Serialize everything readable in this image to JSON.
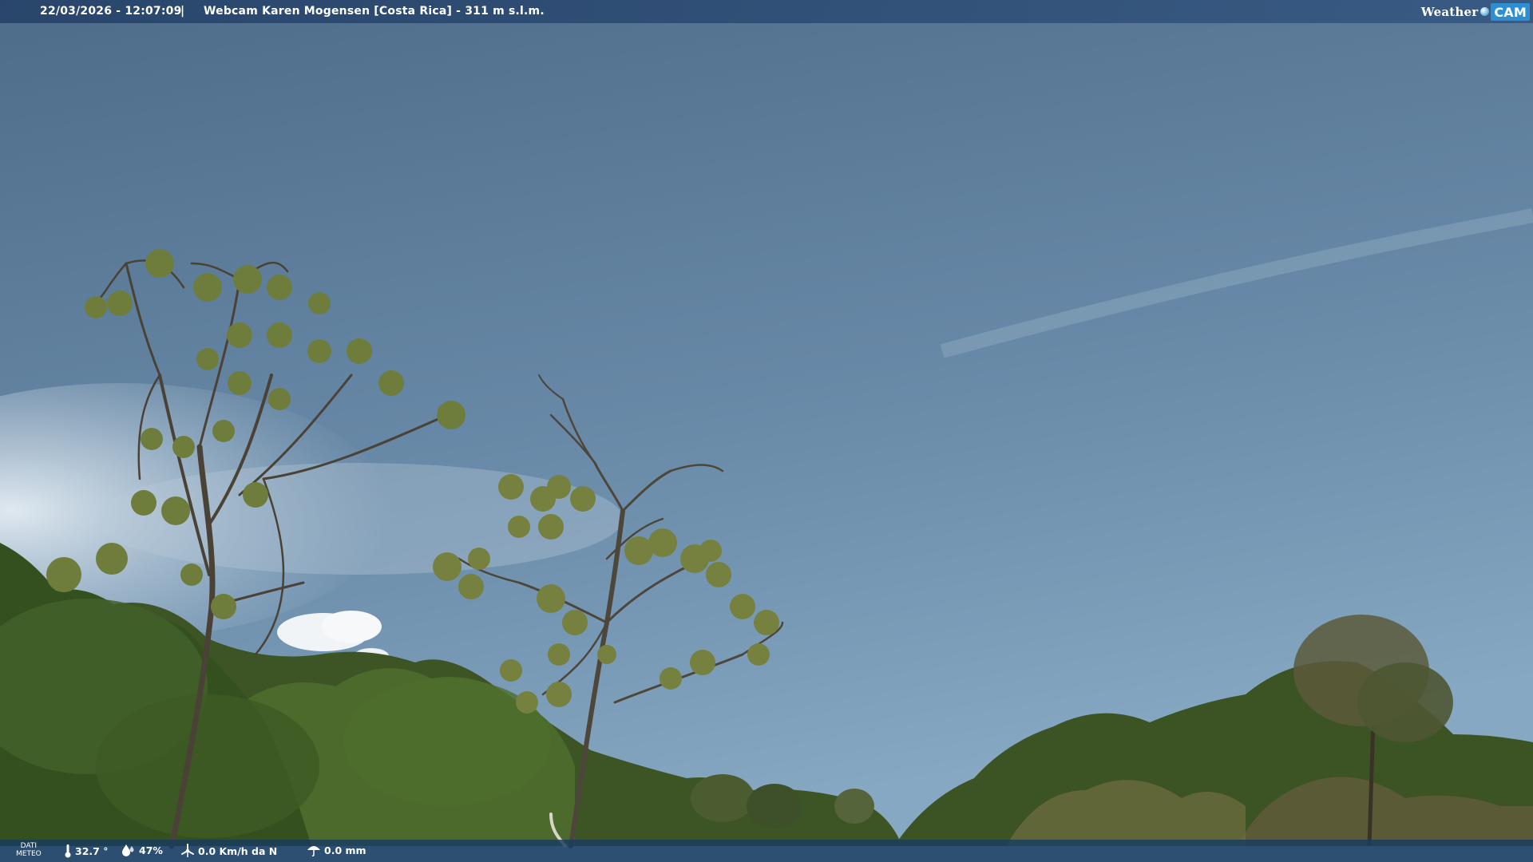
{
  "header": {
    "timestamp": "22/03/2026 - 12:07:09",
    "separator": "|",
    "title": "Webcam Karen Mogensen [Costa Rica] - 311 m s.l.m."
  },
  "logo": {
    "word": "Weather",
    "cam": "CAM"
  },
  "footer": {
    "dati_line1": "DATI",
    "dati_line2": "METEO",
    "temperature": "32.7 °",
    "humidity": "47%",
    "wind": "0.0 Km/h da N",
    "rain": "0.0 mm"
  },
  "icons": {
    "temperature": "thermometer-icon",
    "humidity": "humidity-drop-icon",
    "wind": "wind-icon",
    "rain": "rain-icon"
  },
  "colors": {
    "sky_top": "#4f6e8c",
    "sky_bottom": "#7a9ab6",
    "bar": "#274a72",
    "logo_accent": "#2d8fd2"
  }
}
